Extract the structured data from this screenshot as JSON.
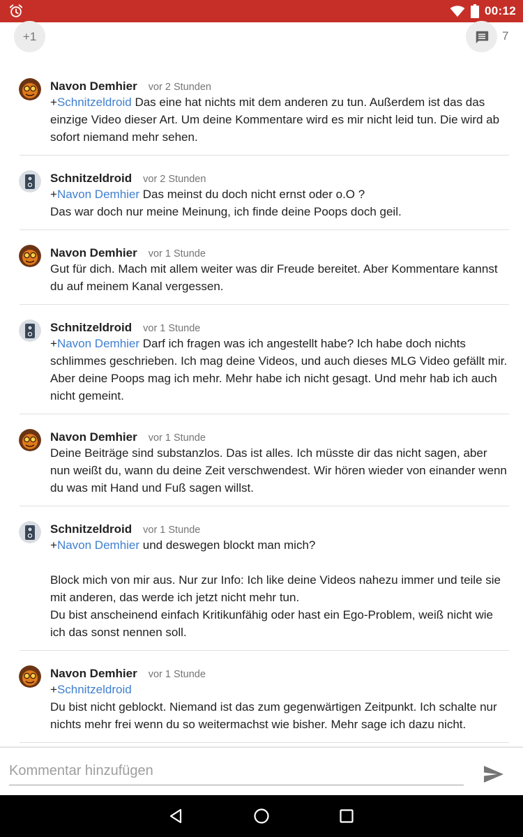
{
  "status_bar": {
    "time": "00:12",
    "icons": [
      "alarm-icon",
      "wifi-icon",
      "battery-icon"
    ]
  },
  "actions": {
    "plus_one_label": "+1",
    "comment_count": "7"
  },
  "colors": {
    "status_bar": "#c62f27",
    "mention": "#3f7fd0"
  },
  "comments": [
    {
      "author": "Navon Demhier",
      "avatar": "orange-face",
      "time": "vor 2 Stunden",
      "lines": [
        [
          "+",
          "Schnitzeldroid",
          " Das eine hat nichts mit dem anderen zu tun. Außerdem ist das das einzige Video dieser Art. Um deine Kommentare wird es mir nicht leid tun. Die wird ab sofort niemand mehr sehen."
        ]
      ]
    },
    {
      "author": "Schnitzeldroid",
      "avatar": "robot-speaker",
      "time": "vor 2 Stunden",
      "lines": [
        [
          "+",
          "Navon Demhier",
          " Das meinst du doch nicht ernst oder o.O ?"
        ],
        [
          "",
          "",
          "Das war doch nur meine Meinung, ich finde deine Poops doch geil."
        ]
      ]
    },
    {
      "author": "Navon Demhier",
      "avatar": "orange-face",
      "time": "vor 1 Stunde",
      "lines": [
        [
          "",
          "",
          "Gut für dich. Mach mit allem weiter was dir Freude bereitet. Aber Kommentare kannst du auf meinem Kanal vergessen."
        ]
      ]
    },
    {
      "author": "Schnitzeldroid",
      "avatar": "robot-speaker",
      "time": "vor 1 Stunde",
      "lines": [
        [
          "+",
          "Navon Demhier",
          " Darf ich fragen was ich angestellt habe? Ich habe doch nichts schlimmes geschrieben. Ich mag deine Videos, und auch dieses MLG Video gefällt mir. Aber deine Poops mag ich mehr. Mehr habe ich nicht gesagt. Und mehr hab ich auch nicht gemeint."
        ]
      ]
    },
    {
      "author": "Navon Demhier",
      "avatar": "orange-face",
      "time": "vor 1 Stunde",
      "lines": [
        [
          "",
          "",
          "Deine Beiträge sind substanzlos. Das ist alles. Ich müsste dir das nicht sagen, aber nun weißt du, wann du deine Zeit verschwendest. Wir hören wieder von einander wenn du was mit Hand und Fuß sagen willst."
        ]
      ]
    },
    {
      "author": "Schnitzeldroid",
      "avatar": "robot-speaker",
      "time": "vor 1 Stunde",
      "lines": [
        [
          "+",
          "Navon Demhier",
          " und deswegen blockt man mich?"
        ],
        [
          "",
          "",
          ""
        ],
        [
          "",
          "",
          "Block mich von mir aus. Nur zur Info: Ich like deine Videos nahezu immer und teile sie mit anderen, das werde ich jetzt nicht mehr tun."
        ],
        [
          "",
          "",
          "Du bist anscheinend einfach Kritikunfähig oder hast ein Ego-Problem, weiß nicht wie ich das sonst nennen soll."
        ]
      ]
    },
    {
      "author": "Navon Demhier",
      "avatar": "orange-face",
      "time": "vor 1 Stunde",
      "lines": [
        [
          "+",
          "Schnitzeldroid",
          ""
        ],
        [
          "",
          "",
          "Du bist nicht geblockt. Niemand ist das zum gegenwärtigen Zeitpunkt. Ich schalte nur nichts mehr frei wenn du so weitermachst wie bisher. Mehr sage ich dazu nicht."
        ]
      ]
    }
  ],
  "compose": {
    "placeholder": "Kommentar hinzufügen"
  },
  "navbar": {
    "buttons": [
      "back-icon",
      "home-icon",
      "recents-icon"
    ]
  }
}
